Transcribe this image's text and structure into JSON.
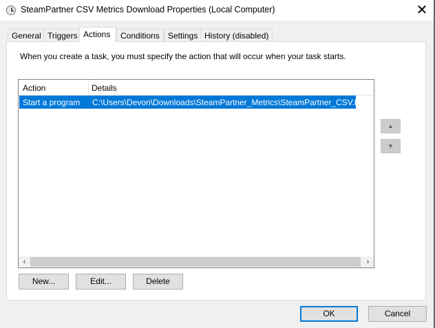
{
  "window": {
    "title": "SteamPartner CSV Metrics Download Properties (Local Computer)",
    "close": "✕"
  },
  "tabs": [
    {
      "label": "General"
    },
    {
      "label": "Triggers"
    },
    {
      "label": "Actions",
      "active": true
    },
    {
      "label": "Conditions"
    },
    {
      "label": "Settings"
    },
    {
      "label": "History (disabled)"
    }
  ],
  "actions": {
    "description": "When you create a task, you must specify the action that will occur when your task starts.",
    "columns": [
      "Action",
      "Details"
    ],
    "rows": [
      {
        "action": "Start a program",
        "details": "C:\\Users\\Devon\\Downloads\\SteamPartner_Metrics\\SteamPartner_CSV.bat",
        "selected": true
      }
    ],
    "new": "New...",
    "edit": "Edit...",
    "delete": "Delete",
    "move_up": "▲",
    "move_down": "▼"
  },
  "footer": {
    "ok": "OK",
    "cancel": "Cancel"
  },
  "colors": {
    "selection": "#0078d7"
  }
}
